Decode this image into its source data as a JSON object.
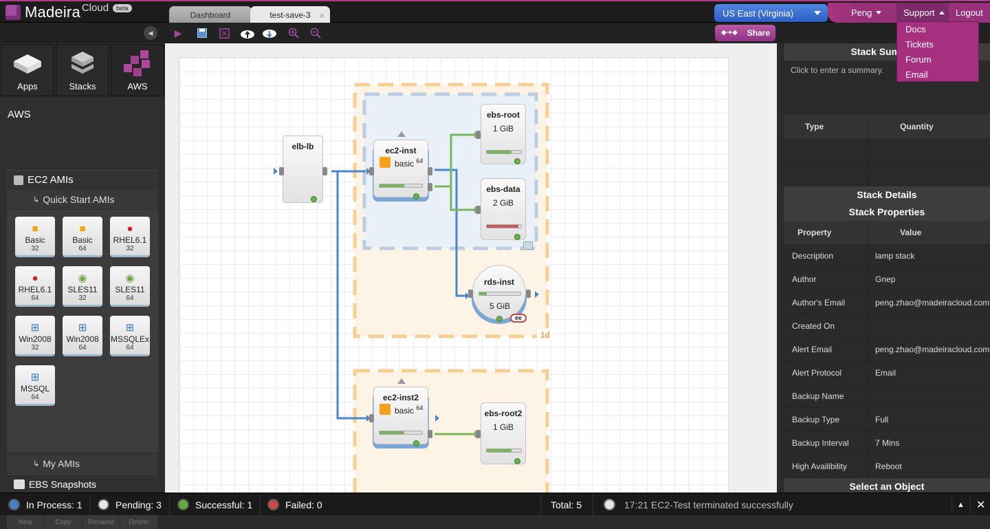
{
  "app": {
    "name": "Madeira",
    "cloud": "Cloud",
    "beta": "beta"
  },
  "tabs": [
    {
      "label": "Dashboard"
    },
    {
      "label": "test-save-3",
      "close": "×"
    }
  ],
  "region": "US East (Virginia)",
  "user": {
    "name": "Peng",
    "support": "Support",
    "logout": "Logout"
  },
  "support_menu": [
    "Docs",
    "Tickets",
    "Forum",
    "Email"
  ],
  "toolbar": {
    "share": "Share",
    "tools": [
      "run-icon",
      "save-icon",
      "export-png-icon",
      "upload-cloud-icon",
      "download-cloud-icon",
      "zoom-in-icon",
      "zoom-out-icon"
    ]
  },
  "left_tabs": [
    {
      "label": "Apps"
    },
    {
      "label": "Stacks"
    },
    {
      "label": "AWS"
    }
  ],
  "left": {
    "section": "AWS",
    "ec2_amis": "EC2 AMIs",
    "quick_start": "Quick Start AMIs",
    "amis": [
      {
        "name": "Basic",
        "bits": "32",
        "icon": "amazon-icon"
      },
      {
        "name": "Basic",
        "bits": "64",
        "icon": "amazon-icon"
      },
      {
        "name": "RHEL6.1",
        "bits": "32",
        "icon": "redhat-icon"
      },
      {
        "name": "RHEL6.1",
        "bits": "64",
        "icon": "redhat-icon"
      },
      {
        "name": "SLES11",
        "bits": "32",
        "icon": "suse-icon"
      },
      {
        "name": "SLES11",
        "bits": "64",
        "icon": "suse-icon"
      },
      {
        "name": "Win2008",
        "bits": "32",
        "icon": "windows-icon"
      },
      {
        "name": "Win2008",
        "bits": "64",
        "icon": "windows-icon"
      },
      {
        "name": "MSSQLEx",
        "bits": "64",
        "icon": "windows-icon"
      },
      {
        "name": "MSSQL",
        "bits": "64",
        "icon": "windows-icon"
      }
    ],
    "my_amis": "My AMIs",
    "ebs_snapshots": "EBS Snapshots",
    "snapshot_actions": [
      "New",
      "Copy",
      "Rename",
      "Delete"
    ]
  },
  "canvas": {
    "nodes": {
      "elb": {
        "title": "elb-lb"
      },
      "ec2_inst": {
        "title": "ec2-inst",
        "ami": "basic",
        "bits": "64"
      },
      "ebs_root": {
        "title": "ebs-root",
        "size": "1 GiB"
      },
      "ebs_data": {
        "title": "ebs-data",
        "size": "2 GiB"
      },
      "rds_inst": {
        "title": "rds-inst",
        "size": "5 GiB",
        "badge": "ee"
      },
      "ec2_inst2": {
        "title": "ec2-inst2",
        "ami": "basic",
        "bits": "64"
      },
      "ebs_root2": {
        "title": "ebs-root2",
        "size": "1 GiB"
      }
    },
    "az_label": "1d"
  },
  "right": {
    "summary_title": "Stack Summary",
    "summary_placeholder": "Click to enter a summary.",
    "summary_cols": [
      "Type",
      "Quantity"
    ],
    "details_title": "Stack Details",
    "props_title": "Stack Properties",
    "props_cols": [
      "Property",
      "Value"
    ],
    "properties": [
      {
        "k": "Description",
        "v": "lamp stack"
      },
      {
        "k": "Author",
        "v": "Gnep"
      },
      {
        "k": "Author's Email",
        "v": "peng.zhao@madeiracloud.com"
      },
      {
        "k": "Created On",
        "v": ""
      },
      {
        "k": "Alert Email",
        "v": "peng.zhao@madeiracloud.com"
      },
      {
        "k": "Alert Protocol",
        "v": "Email"
      },
      {
        "k": "Backup Name",
        "v": ""
      },
      {
        "k": "Backup Type",
        "v": "Full"
      },
      {
        "k": "Backup Interval",
        "v": "7 Mins"
      },
      {
        "k": "High Availibility",
        "v": "Reboot"
      }
    ],
    "select_object": "Select an Object"
  },
  "status": {
    "in_process": "In Process: 1",
    "pending": "Pending: 3",
    "successful": "Successful: 1",
    "failed": "Failed: 0",
    "total": "Total: 5",
    "message": "17:21 EC2-Test terminated successfully",
    "colors": {
      "in_process": "#4a7fc1",
      "pending": "#e6e6e6",
      "successful": "#5cae3c",
      "failed": "#c84a4a"
    }
  }
}
